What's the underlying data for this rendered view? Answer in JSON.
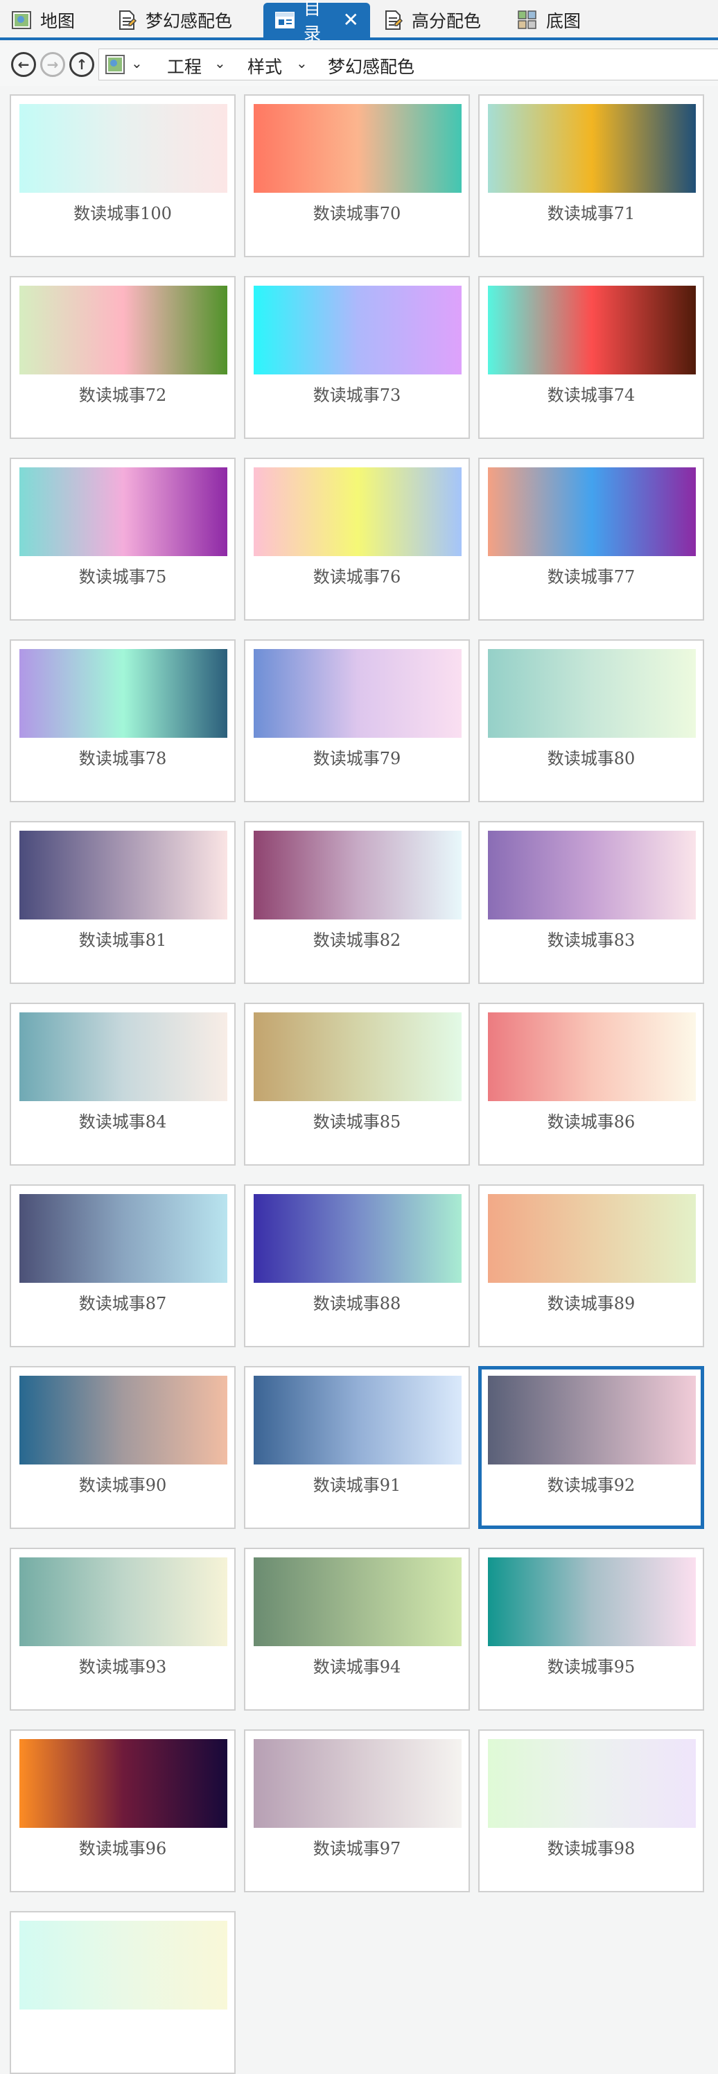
{
  "tabs": [
    {
      "label": "地图",
      "icon": "map-icon",
      "active": false
    },
    {
      "label": "梦幻感配色",
      "icon": "style-icon",
      "active": false
    },
    {
      "label": "目录",
      "icon": "catalog-icon",
      "active": true
    },
    {
      "label": "高分配色",
      "icon": "style-icon",
      "active": false
    },
    {
      "label": "底图",
      "icon": "basemap-icon",
      "active": false
    }
  ],
  "breadcrumb": {
    "items": [
      "工程",
      "样式",
      "梦幻感配色"
    ]
  },
  "colors": {
    "accent": "#1c6fb8",
    "card_border": "#cfcfcf"
  },
  "selected_item": "数读城事92",
  "items": [
    {
      "name": "数读城事100",
      "stops": [
        "#c4fbf6",
        "#e8f1ef",
        "#fce6e6"
      ]
    },
    {
      "name": "数读城事70",
      "stops": [
        "#ff7862",
        "#fcb58e",
        "#42c6b2"
      ]
    },
    {
      "name": "数读城事71",
      "stops": [
        "#a6ded4",
        "#f2b522",
        "#1f4f78"
      ]
    },
    {
      "name": "数读城事72",
      "stops": [
        "#d6edc0",
        "#feb6c2",
        "#509229"
      ]
    },
    {
      "name": "数读城事73",
      "stops": [
        "#2cf6fb",
        "#aeb8fb",
        "#dea2fb"
      ]
    },
    {
      "name": "数读城事74",
      "stops": [
        "#57f5e0",
        "#fc4d4d",
        "#501b0a"
      ]
    },
    {
      "name": "数读城事75",
      "stops": [
        "#7fdbd6",
        "#f4addb",
        "#8e29a6"
      ]
    },
    {
      "name": "数读城事76",
      "stops": [
        "#fdc1d2",
        "#f5f876",
        "#a4c4fa"
      ]
    },
    {
      "name": "数读城事77",
      "stops": [
        "#f4a183",
        "#43a2ee",
        "#8c2aa4"
      ]
    },
    {
      "name": "数读城事78",
      "stops": [
        "#b198e6",
        "#a2f7d8",
        "#2b5e7b"
      ]
    },
    {
      "name": "数读城事79",
      "stops": [
        "#6e8fd6",
        "#ddc6ed",
        "#fadff1"
      ]
    },
    {
      "name": "数读城事80",
      "stops": [
        "#95d0c8",
        "#c8e7d8",
        "#edfadf"
      ]
    },
    {
      "name": "数读城事81",
      "stops": [
        "#4b4c7c",
        "#a797b2",
        "#fae4e4"
      ]
    },
    {
      "name": "数读城事82",
      "stops": [
        "#8f4470",
        "#c7aac5",
        "#e8f8fb"
      ]
    },
    {
      "name": "数读城事83",
      "stops": [
        "#8a6db5",
        "#c7a2d4",
        "#fae4ea"
      ]
    },
    {
      "name": "数读城事84",
      "stops": [
        "#6fa9b4",
        "#c7d8dc",
        "#f8ede6"
      ]
    },
    {
      "name": "数读城事85",
      "stops": [
        "#c3a46e",
        "#d4d4a8",
        "#e2fae6"
      ]
    },
    {
      "name": "数读城事86",
      "stops": [
        "#ec7b80",
        "#f9c6b8",
        "#fdf8e8"
      ]
    },
    {
      "name": "数读城事87",
      "stops": [
        "#4c5177",
        "#8aa5c0",
        "#b9e4ef"
      ]
    },
    {
      "name": "数读城事88",
      "stops": [
        "#3a2fa9",
        "#788cc9",
        "#a9ecd2"
      ]
    },
    {
      "name": "数读城事89",
      "stops": [
        "#f2a987",
        "#eccfa6",
        "#e3f1c8"
      ]
    },
    {
      "name": "数读城事90",
      "stops": [
        "#276890",
        "#a49a9d",
        "#f1bda3"
      ]
    },
    {
      "name": "数读城事91",
      "stops": [
        "#3b6494",
        "#93afd6",
        "#dae9fb"
      ]
    },
    {
      "name": "数读城事92",
      "stops": [
        "#5a6078",
        "#a697a7",
        "#f1ccd8"
      ]
    },
    {
      "name": "数读城事93",
      "stops": [
        "#75ada5",
        "#bfd6c9",
        "#f6f3d7"
      ]
    },
    {
      "name": "数读城事94",
      "stops": [
        "#6b8c71",
        "#a2bb90",
        "#d4e9ae"
      ]
    },
    {
      "name": "数读城事95",
      "stops": [
        "#12968f",
        "#a8c0c8",
        "#fbdfef"
      ]
    },
    {
      "name": "数读城事96",
      "stops": [
        "#fc8c24",
        "#6e1a3b",
        "#18093a"
      ]
    },
    {
      "name": "数读城事97",
      "stops": [
        "#b7a0b4",
        "#d8cbd2",
        "#f5f3f0"
      ]
    },
    {
      "name": "数读城事98",
      "stops": [
        "#dffad6",
        "#ecf1ef",
        "#efe5fb"
      ]
    },
    {
      "name": "",
      "stops": [
        "#d3fbf2",
        "#eaf9e6",
        "#f9f8d8"
      ]
    }
  ]
}
